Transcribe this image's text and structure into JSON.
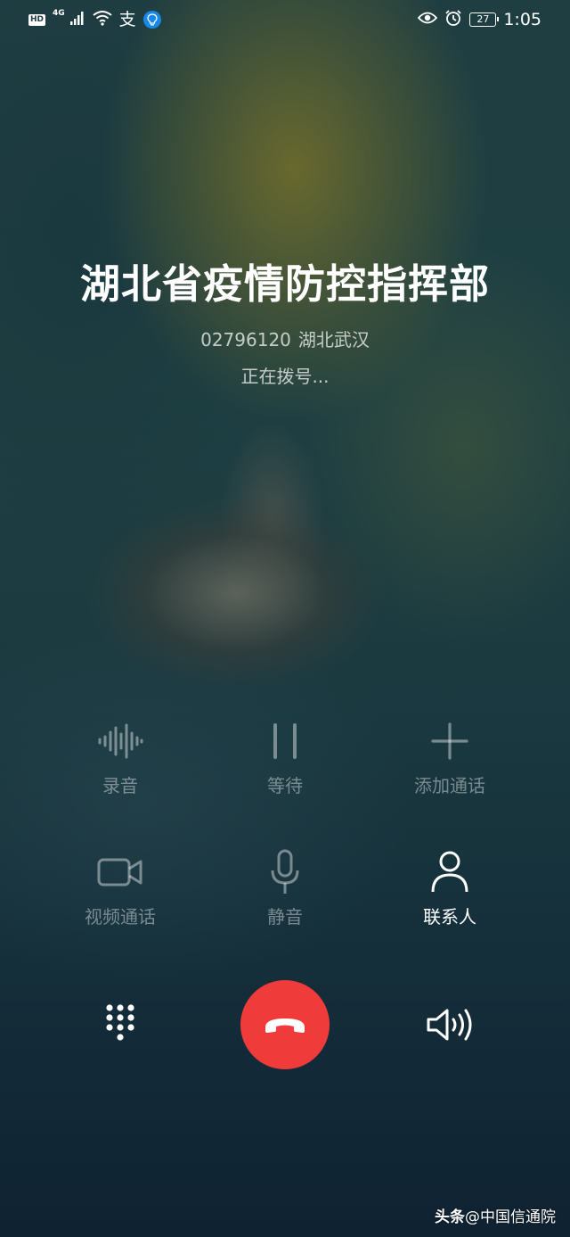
{
  "status_bar": {
    "hd": "HD",
    "network": "4G",
    "alipay_glyph": "支",
    "battery": "27",
    "time": "1:05",
    "icons": [
      "hd-icon",
      "signal-icon",
      "wifi-icon",
      "alipay-icon",
      "bulb-icon",
      "eye-icon",
      "alarm-icon",
      "battery-icon"
    ]
  },
  "caller": {
    "name": "湖北省疫情防控指挥部",
    "number": "02796120",
    "location": "湖北武汉",
    "status": "正在拨号..."
  },
  "actions": {
    "record": {
      "label": "录音",
      "icon": "waveform-icon",
      "enabled": false
    },
    "hold": {
      "label": "等待",
      "icon": "pause-icon",
      "enabled": false
    },
    "add_call": {
      "label": "添加通话",
      "icon": "plus-icon",
      "enabled": false
    },
    "video_call": {
      "label": "视频通话",
      "icon": "video-camera-icon",
      "enabled": false
    },
    "mute": {
      "label": "静音",
      "icon": "microphone-icon",
      "enabled": false
    },
    "contacts": {
      "label": "联系人",
      "icon": "person-icon",
      "enabled": true
    }
  },
  "controls": {
    "dialpad": "dialpad-icon",
    "end_call": "hang-up-icon",
    "speaker": "speaker-icon"
  },
  "colors": {
    "end_call": "#ef3b3a",
    "bulb": "#1787e8"
  },
  "watermark": {
    "brand": "头条",
    "handle": "@中国信通院"
  }
}
